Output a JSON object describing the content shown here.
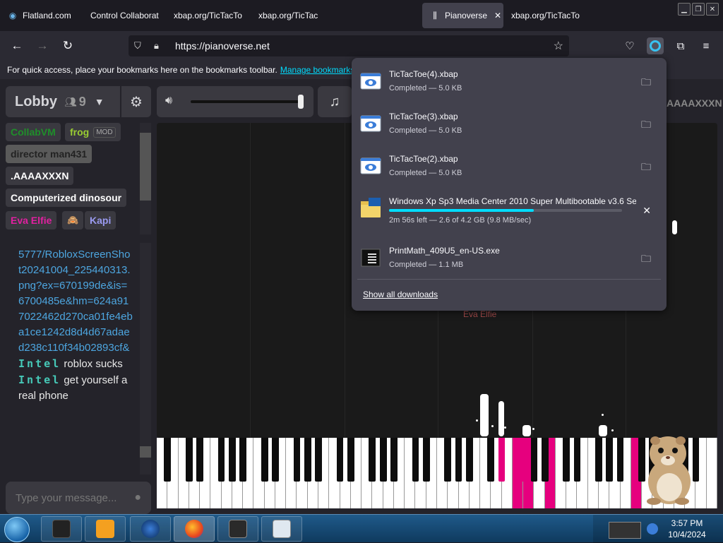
{
  "browser": {
    "tabs": [
      {
        "label": "Flatland.com",
        "active": false
      },
      {
        "label": "Control Collaborat",
        "active": false
      },
      {
        "label": "xbap.org/TicTacTo",
        "active": false
      },
      {
        "label": "xbap.org/TicTac",
        "active": false
      },
      {
        "label": "Pianoverse",
        "active": true
      },
      {
        "label": "xbap.org/TicTacTo",
        "active": false
      }
    ],
    "url": "https://pianoverse.net",
    "bookmarks_hint": "For quick access, place your bookmarks here on the bookmarks toolbar.",
    "bookmarks_link": "Manage bookmarks."
  },
  "downloads": {
    "items": [
      {
        "name": "TicTacToe(4).xbap",
        "status": "Completed — 5.0 KB",
        "icon": "xbap-file-icon"
      },
      {
        "name": "TicTacToe(3).xbap",
        "status": "Completed — 5.0 KB",
        "icon": "xbap-file-icon"
      },
      {
        "name": "TicTacToe(2).xbap",
        "status": "Completed — 5.0 KB",
        "icon": "xbap-file-icon"
      },
      {
        "name": "Windows Xp Sp3 Media Center 2010 Super Multibootable v3.6 Sep",
        "status": "2m 56s left — 2.6 of 4.2 GB (9.8 MB/sec)",
        "icon": "iso-file-icon",
        "progress": 0.62
      },
      {
        "name": "PrintMath_409U5_en-US.exe",
        "status": "Completed — 1.1 MB",
        "icon": "exe-file-icon"
      }
    ],
    "show_all": "Show all downloads"
  },
  "pianoverse": {
    "room_name": "Lobby",
    "user_count": "9",
    "users": [
      {
        "name": "CollabVM",
        "color": "#1f8f2a"
      },
      {
        "name": "frog",
        "color": "#9acd32",
        "badge": "MOD"
      },
      {
        "name": "director man431",
        "color": "#222222"
      },
      {
        "name": ".AAAAXXXN",
        "color": "#ffffff"
      },
      {
        "name": "Computerized dinosour",
        "color": "#ffffff"
      },
      {
        "name": "Eva Elfie",
        "color": "#e020a0"
      },
      {
        "name": "",
        "color": "#ff9933",
        "emoji": "🙈"
      },
      {
        "name": "Kapi",
        "color": "#9a9af0"
      }
    ],
    "chat_link_text": "5777/RobloxScreenShot20241004_225440313.png?ex=670199de&is=6700485e&hm=624a917022462d270ca01fe4eba1ce1242d8d4d67adaed238c110f34b02893cf&",
    "messages": [
      {
        "nick": "Intel",
        "text": "roblox sucks"
      },
      {
        "nick": "Intel",
        "text": "get yourself a real phone"
      }
    ],
    "chat_placeholder": "Type your message...",
    "top_right_name": "AAAAXXXN",
    "ghost_name": "Eva Elfie"
  },
  "taskbar": {
    "time": "3:57 PM",
    "date": "10/4/2024"
  },
  "colors": {
    "accent": "#00ddff",
    "piano_lit": "#e6007e"
  }
}
